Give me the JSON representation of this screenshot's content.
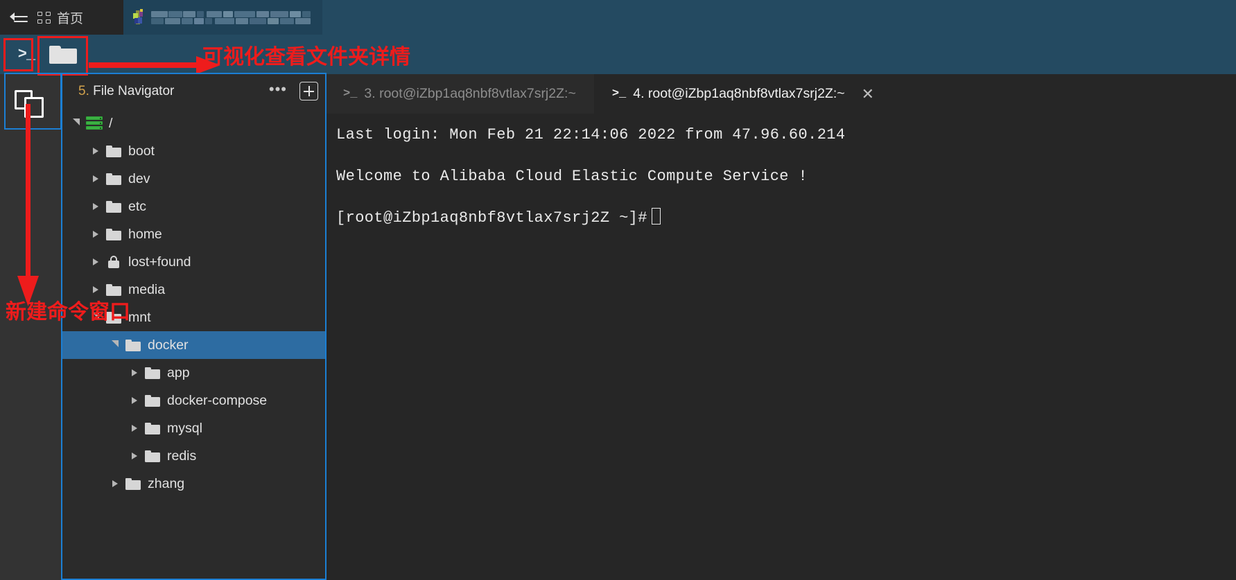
{
  "topbar": {
    "menu_icon": "collapse-menu-icon",
    "home_label": "首页",
    "home_icon": "grid-icon",
    "session_tab_label": "",
    "session_tab_blurred": true
  },
  "toolbar": {
    "terminal_button_glyph": ">_",
    "folder_button_icon": "folder-icon"
  },
  "rail": {
    "copy_button_icon": "copy-files-icon"
  },
  "file_panel": {
    "title_number": "5.",
    "title": " File Navigator",
    "more_label": "•••",
    "add_label": "+",
    "tree": [
      {
        "label": "/",
        "icon": "server-icon",
        "indent": 0,
        "state": "open",
        "selected": false
      },
      {
        "label": "boot",
        "icon": "folder-icon",
        "indent": 1,
        "state": "closed",
        "selected": false
      },
      {
        "label": "dev",
        "icon": "folder-icon",
        "indent": 1,
        "state": "closed",
        "selected": false
      },
      {
        "label": "etc",
        "icon": "folder-icon",
        "indent": 1,
        "state": "closed",
        "selected": false
      },
      {
        "label": "home",
        "icon": "folder-icon",
        "indent": 1,
        "state": "closed",
        "selected": false
      },
      {
        "label": "lost+found",
        "icon": "lock-icon",
        "indent": 1,
        "state": "closed",
        "selected": false
      },
      {
        "label": "media",
        "icon": "folder-icon",
        "indent": 1,
        "state": "closed",
        "selected": false
      },
      {
        "label": "mnt",
        "icon": "folder-icon",
        "indent": 1,
        "state": "open",
        "selected": false
      },
      {
        "label": "docker",
        "icon": "folder-icon",
        "indent": 2,
        "state": "open",
        "selected": true
      },
      {
        "label": "app",
        "icon": "folder-icon",
        "indent": 3,
        "state": "closed",
        "selected": false
      },
      {
        "label": "docker-compose",
        "icon": "folder-icon",
        "indent": 3,
        "state": "closed",
        "selected": false
      },
      {
        "label": "mysql",
        "icon": "folder-icon",
        "indent": 3,
        "state": "closed",
        "selected": false
      },
      {
        "label": "redis",
        "icon": "folder-icon",
        "indent": 3,
        "state": "closed",
        "selected": false
      },
      {
        "label": "zhang",
        "icon": "folder-icon",
        "indent": 2,
        "state": "closed",
        "selected": false
      }
    ]
  },
  "terminal": {
    "tabs": [
      {
        "prompt_glyph": ">_",
        "label": "3. root@iZbp1aq8nbf8vtlax7srj2Z:~",
        "active": false,
        "closable": false
      },
      {
        "prompt_glyph": ">_",
        "label": "4. root@iZbp1aq8nbf8vtlax7srj2Z:~",
        "active": true,
        "closable": true,
        "close_label": "✕"
      }
    ],
    "lines": [
      "Last login: Mon Feb 21 22:14:06 2022 from 47.96.60.214",
      "",
      "Welcome to Alibaba Cloud Elastic Compute Service !",
      "",
      "[root@iZbp1aq8nbf8vtlax7srj2Z ~]#"
    ]
  },
  "annotations": {
    "note_folder": "可视化查看文件夹详情",
    "note_newterm": "新建命令窗口",
    "red": "#ee1c1c",
    "blue": "#1b7fd4"
  }
}
